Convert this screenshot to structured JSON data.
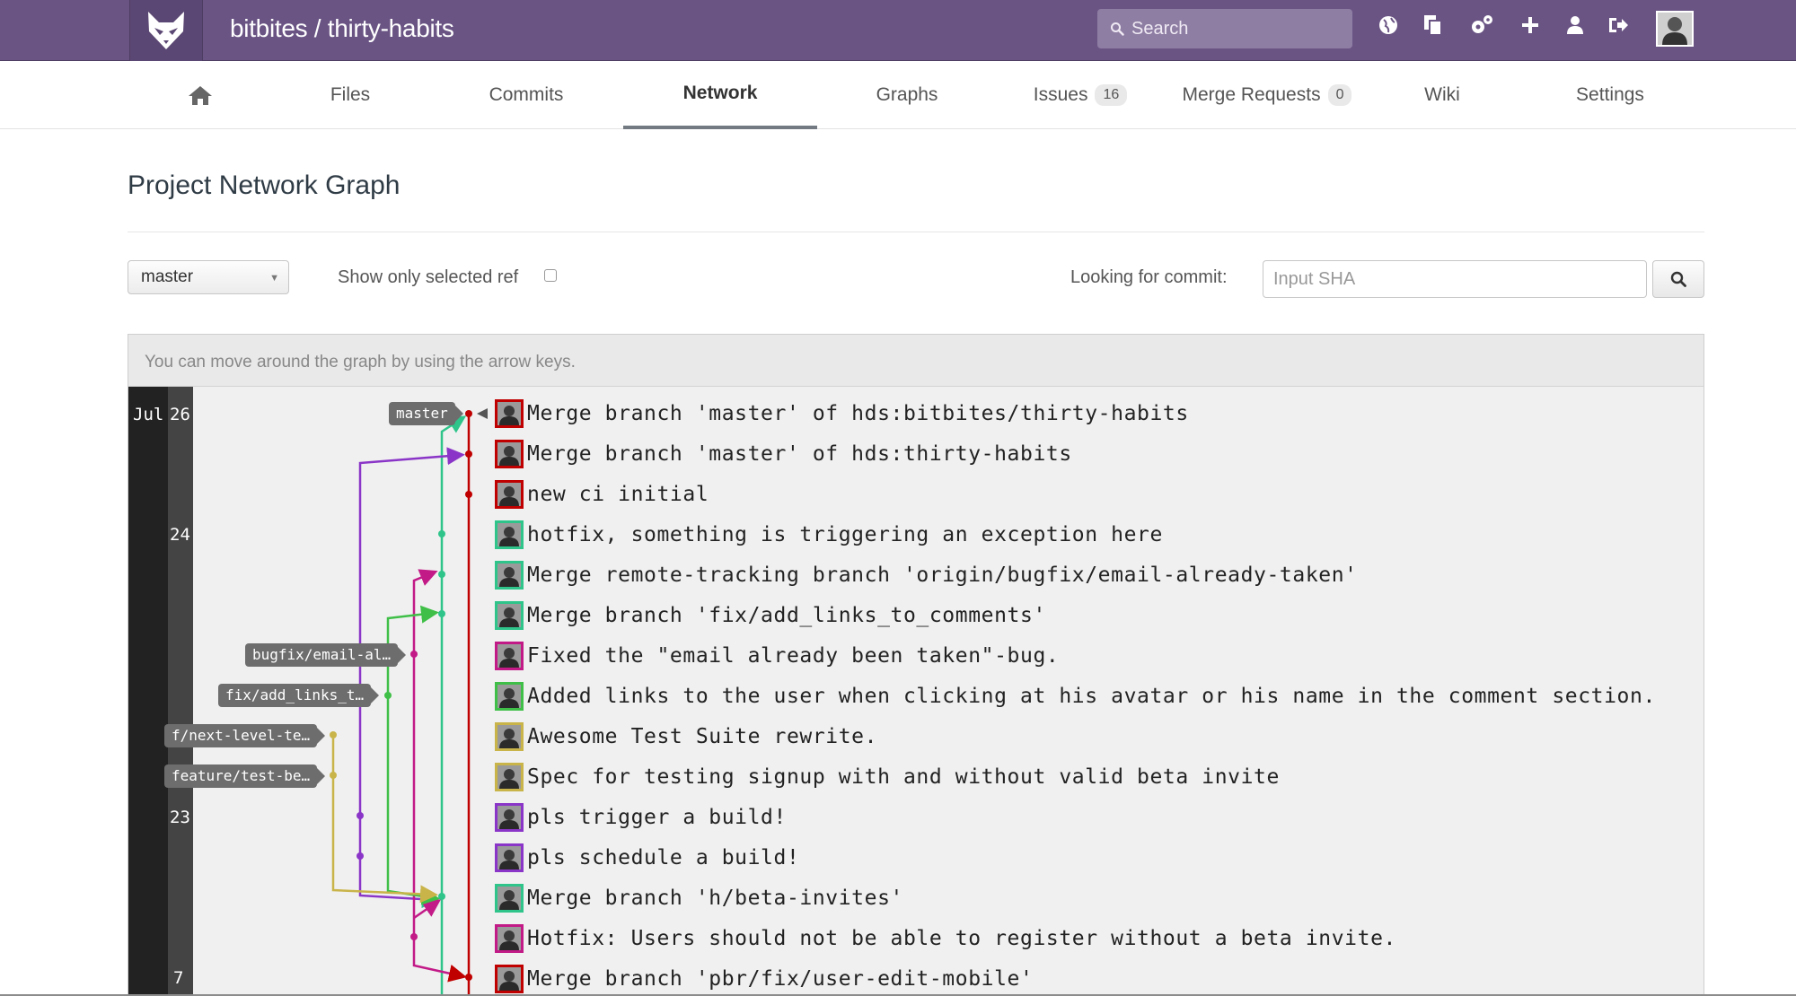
{
  "header": {
    "project_title": "bitbites / thirty-habits",
    "search_placeholder": "Search",
    "logo_icon": "fox-logo-icon",
    "icons": [
      "globe-icon",
      "copy-icon",
      "cogs-icon",
      "plus-icon",
      "user-icon",
      "sign-out-icon"
    ],
    "bg_color": "#6a5484"
  },
  "nav": {
    "home_icon": "home-icon",
    "files": "Files",
    "commits": "Commits",
    "network": "Network",
    "graphs": "Graphs",
    "issues": "Issues",
    "issues_count": "16",
    "merge_requests": "Merge Requests",
    "merge_requests_count": "0",
    "wiki": "Wiki",
    "settings": "Settings"
  },
  "page": {
    "title": "Project Network Graph"
  },
  "controls": {
    "ref_value": "master",
    "show_only_label": "Show only selected ref",
    "show_only_checked": false,
    "looking_label": "Looking for commit:",
    "sha_placeholder": "Input SHA",
    "search_button_icon": "search-icon"
  },
  "graph": {
    "hint": "You can move around the graph by using the arrow keys.",
    "month": "Jul",
    "days": [
      "26",
      "24",
      "23",
      "7"
    ],
    "refs": [
      "master",
      "bugfix/email-al…",
      "fix/add_links_t…",
      "f/next-level-te…",
      "feature/test-be…"
    ],
    "commits": [
      {
        "message": "Merge branch 'master' of hds:bitbites/thirty-habits",
        "color": "#c00000"
      },
      {
        "message": "Merge branch 'master' of hds:thirty-habits",
        "color": "#c00000"
      },
      {
        "message": "new ci initial",
        "color": "#c00000"
      },
      {
        "message": "hotfix, something is triggering an exception here",
        "color": "#2ec48a"
      },
      {
        "message": "Merge remote-tracking branch 'origin/bugfix/email-already-taken'",
        "color": "#2ec48a"
      },
      {
        "message": "Merge branch 'fix/add_links_to_comments'",
        "color": "#2ec48a"
      },
      {
        "message": "Fixed the \"email already been taken\"-bug.",
        "color": "#c21a87"
      },
      {
        "message": "Added links to the user when clicking at his avatar or his name in the comment section.",
        "color": "#3fbf47"
      },
      {
        "message": "Awesome Test Suite rewrite.",
        "color": "#c9b44a"
      },
      {
        "message": "Spec for testing signup with and without valid beta invite",
        "color": "#c9b44a"
      },
      {
        "message": "pls trigger a build!",
        "color": "#8a35c7"
      },
      {
        "message": "pls schedule a build!",
        "color": "#8a35c7"
      },
      {
        "message": "Merge branch 'h/beta-invites'",
        "color": "#2ec48a"
      },
      {
        "message": "Hotfix: Users should not be able to register without a beta invite.",
        "color": "#c21a87"
      },
      {
        "message": "Merge branch 'pbr/fix/user-edit-mobile'",
        "color": "#c00000"
      }
    ]
  }
}
